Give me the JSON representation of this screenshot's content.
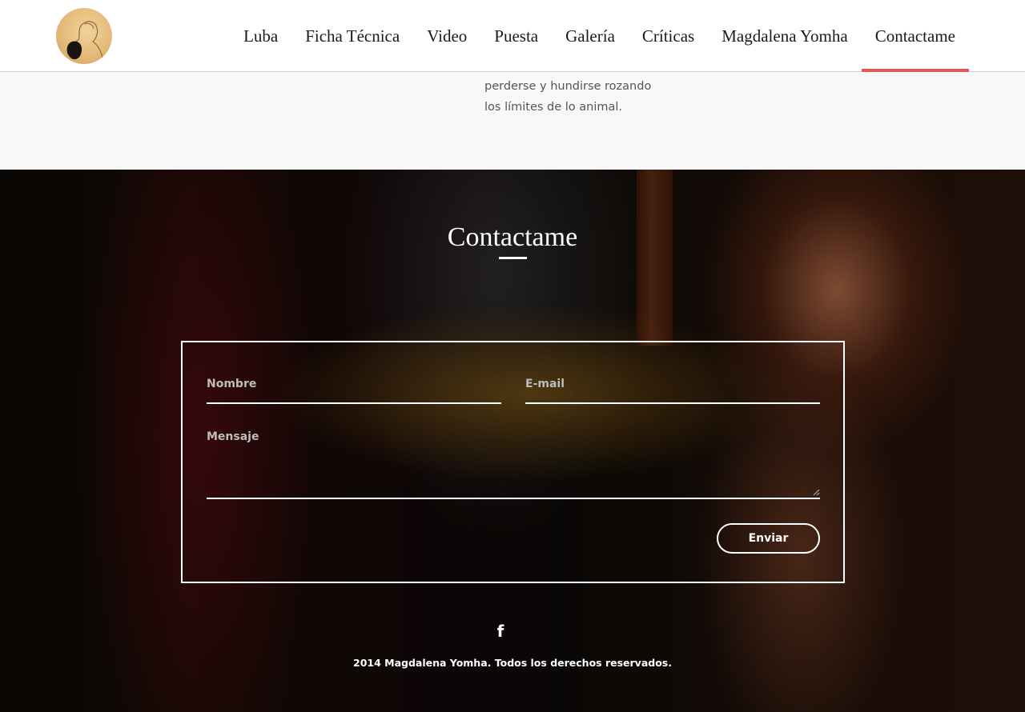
{
  "header": {
    "logo_icon": "portrait-sketch-logo",
    "nav": [
      {
        "label": "Luba"
      },
      {
        "label": "Ficha Técnica"
      },
      {
        "label": "Video"
      },
      {
        "label": "Puesta"
      },
      {
        "label": "Galería"
      },
      {
        "label": "Críticas"
      },
      {
        "label": "Magdalena Yomha"
      },
      {
        "label": "Contactame",
        "active": true
      }
    ],
    "active_color": "#e05a57"
  },
  "intro": {
    "line1": "perderse y hundirse rozando",
    "line2": "los límites de lo animal."
  },
  "contact": {
    "title": "Contactame",
    "form": {
      "name_placeholder": "Nombre",
      "email_placeholder": "E-mail",
      "message_placeholder": "Mensaje",
      "submit_label": "Enviar"
    }
  },
  "footer": {
    "social_icon": "facebook-icon",
    "facebook_glyph": "f",
    "copyright": "2014 Magdalena Yomha. Todos los derechos reservados."
  }
}
